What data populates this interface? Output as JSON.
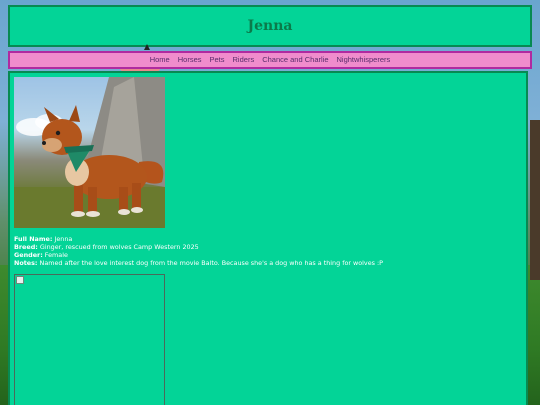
{
  "page": {
    "title": "Jenna"
  },
  "nav": {
    "items": [
      {
        "label": "Home"
      },
      {
        "label": "Horses"
      },
      {
        "label": "Pets"
      },
      {
        "label": "Riders"
      },
      {
        "label": "Chance and Charlie"
      },
      {
        "label": "Nightwhisperers"
      }
    ]
  },
  "profile": {
    "full_name_label": "Full Name:",
    "full_name": "Jenna",
    "breed_label": "Breed:",
    "breed": "Ginger, rescued from wolves Camp Western 2025",
    "gender_label": "Gender:",
    "gender": "Female",
    "notes_label": "Notes:",
    "notes": "Named after the love interest dog from the movie Balto. Because she's a dog who has a thing for wolves :P"
  },
  "colors": {
    "panel_bg": "#03d497",
    "panel_border": "#078a52",
    "nav_bg": "#f08ccc",
    "nav_border": "#b02aa0"
  }
}
